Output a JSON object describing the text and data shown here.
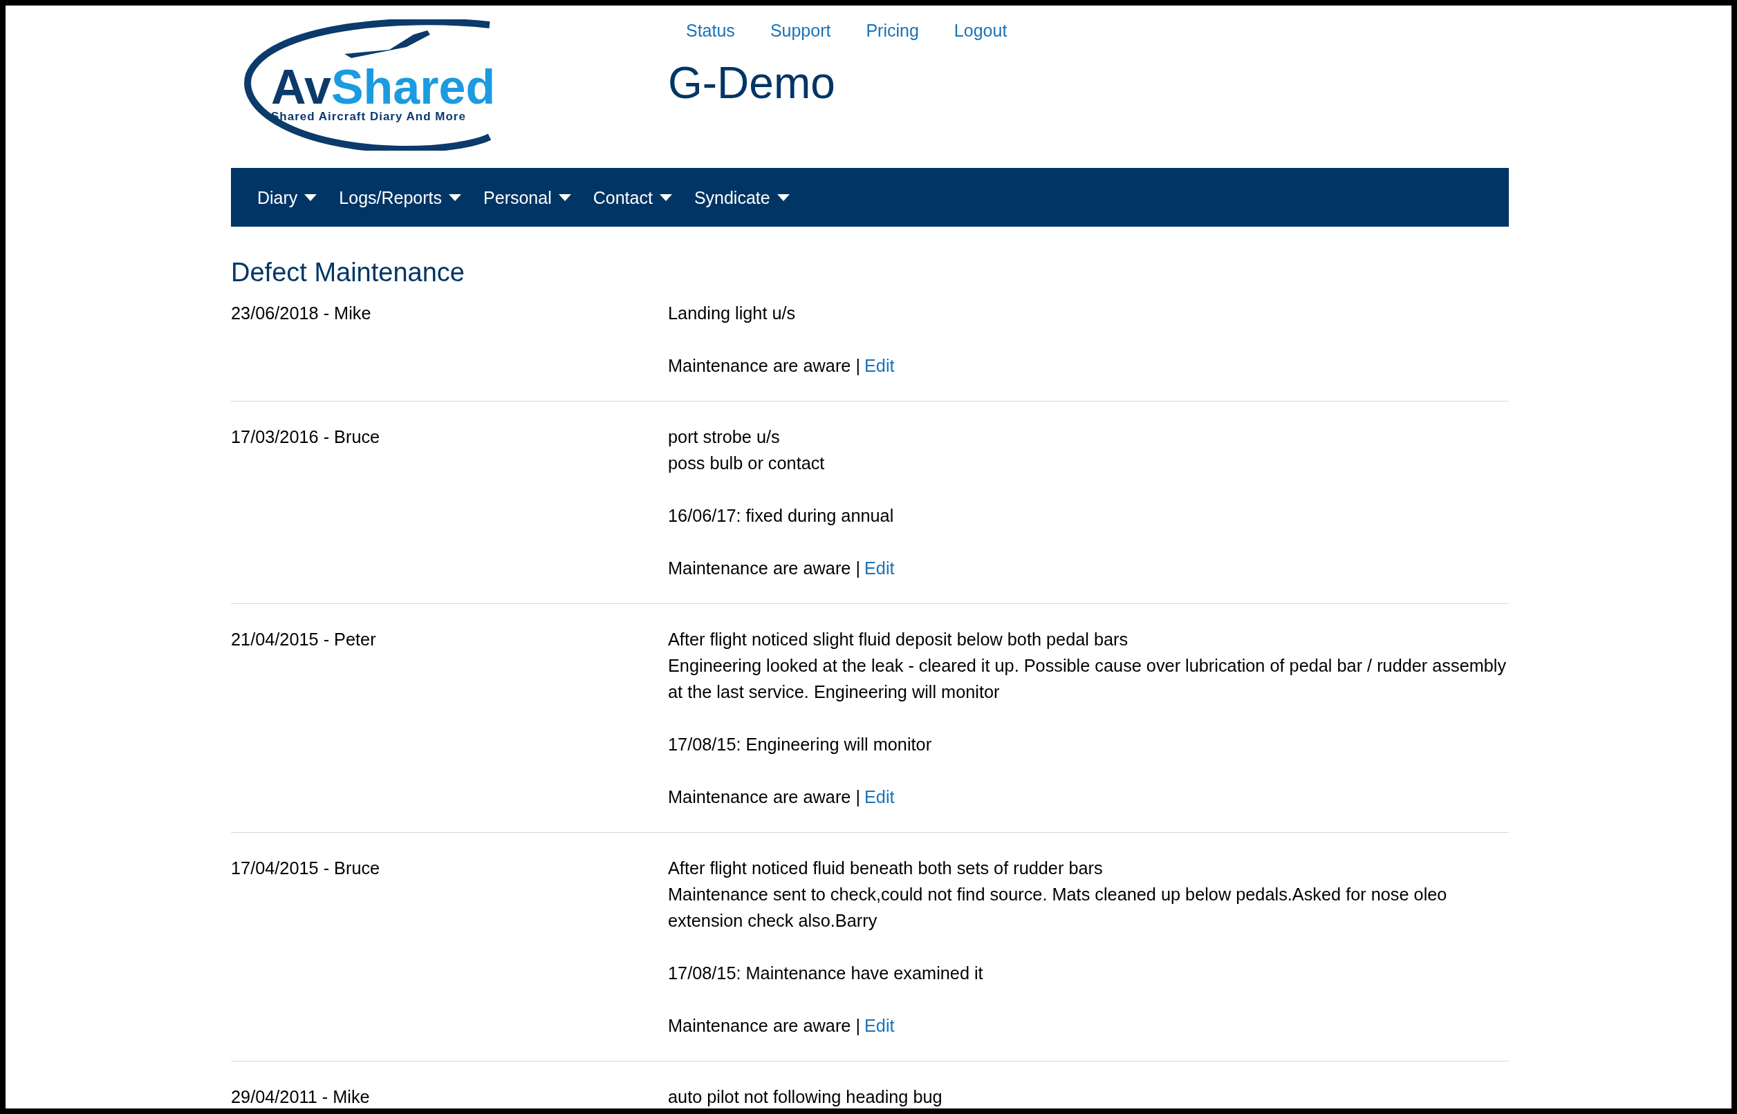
{
  "logo": {
    "title_dark": "Av",
    "title_light": "Shared",
    "tagline": "Shared Aircraft Diary And More"
  },
  "top_links": [
    "Status",
    "Support",
    "Pricing",
    "Logout"
  ],
  "aircraft": "G-Demo",
  "nav": [
    "Diary",
    "Logs/Reports",
    "Personal",
    "Contact",
    "Syndicate"
  ],
  "heading": "Defect Maintenance",
  "defects": [
    {
      "date": "23/06/2018 - Mike",
      "lines": [
        "Landing light u/s"
      ],
      "status": "Maintenance are aware |",
      "edit": "Edit"
    },
    {
      "date": "17/03/2016 - Bruce",
      "lines": [
        "port strobe u/s",
        "poss bulb or contact"
      ],
      "note": "16/06/17: fixed during annual",
      "status": "Maintenance are aware |",
      "edit": "Edit"
    },
    {
      "date": "21/04/2015 - Peter",
      "lines": [
        "After flight noticed slight fluid deposit below both pedal bars",
        "Engineering looked at the leak - cleared it up. Possible cause over lubrication of pedal bar / rudder assembly at the last service. Engineering will monitor"
      ],
      "note": "17/08/15: Engineering will monitor",
      "status": "Maintenance are aware |",
      "edit": "Edit"
    },
    {
      "date": "17/04/2015 - Bruce",
      "lines": [
        "After flight noticed fluid beneath both sets of rudder bars",
        "Maintenance sent to check,could not find source. Mats cleaned up below pedals.Asked for nose oleo extension check also.Barry"
      ],
      "note": "17/08/15: Maintenance have examined it",
      "status": "Maintenance are aware |",
      "edit": "Edit"
    },
    {
      "date": "29/04/2011 - Mike",
      "lines": [
        "auto pilot not following heading bug"
      ]
    }
  ]
}
